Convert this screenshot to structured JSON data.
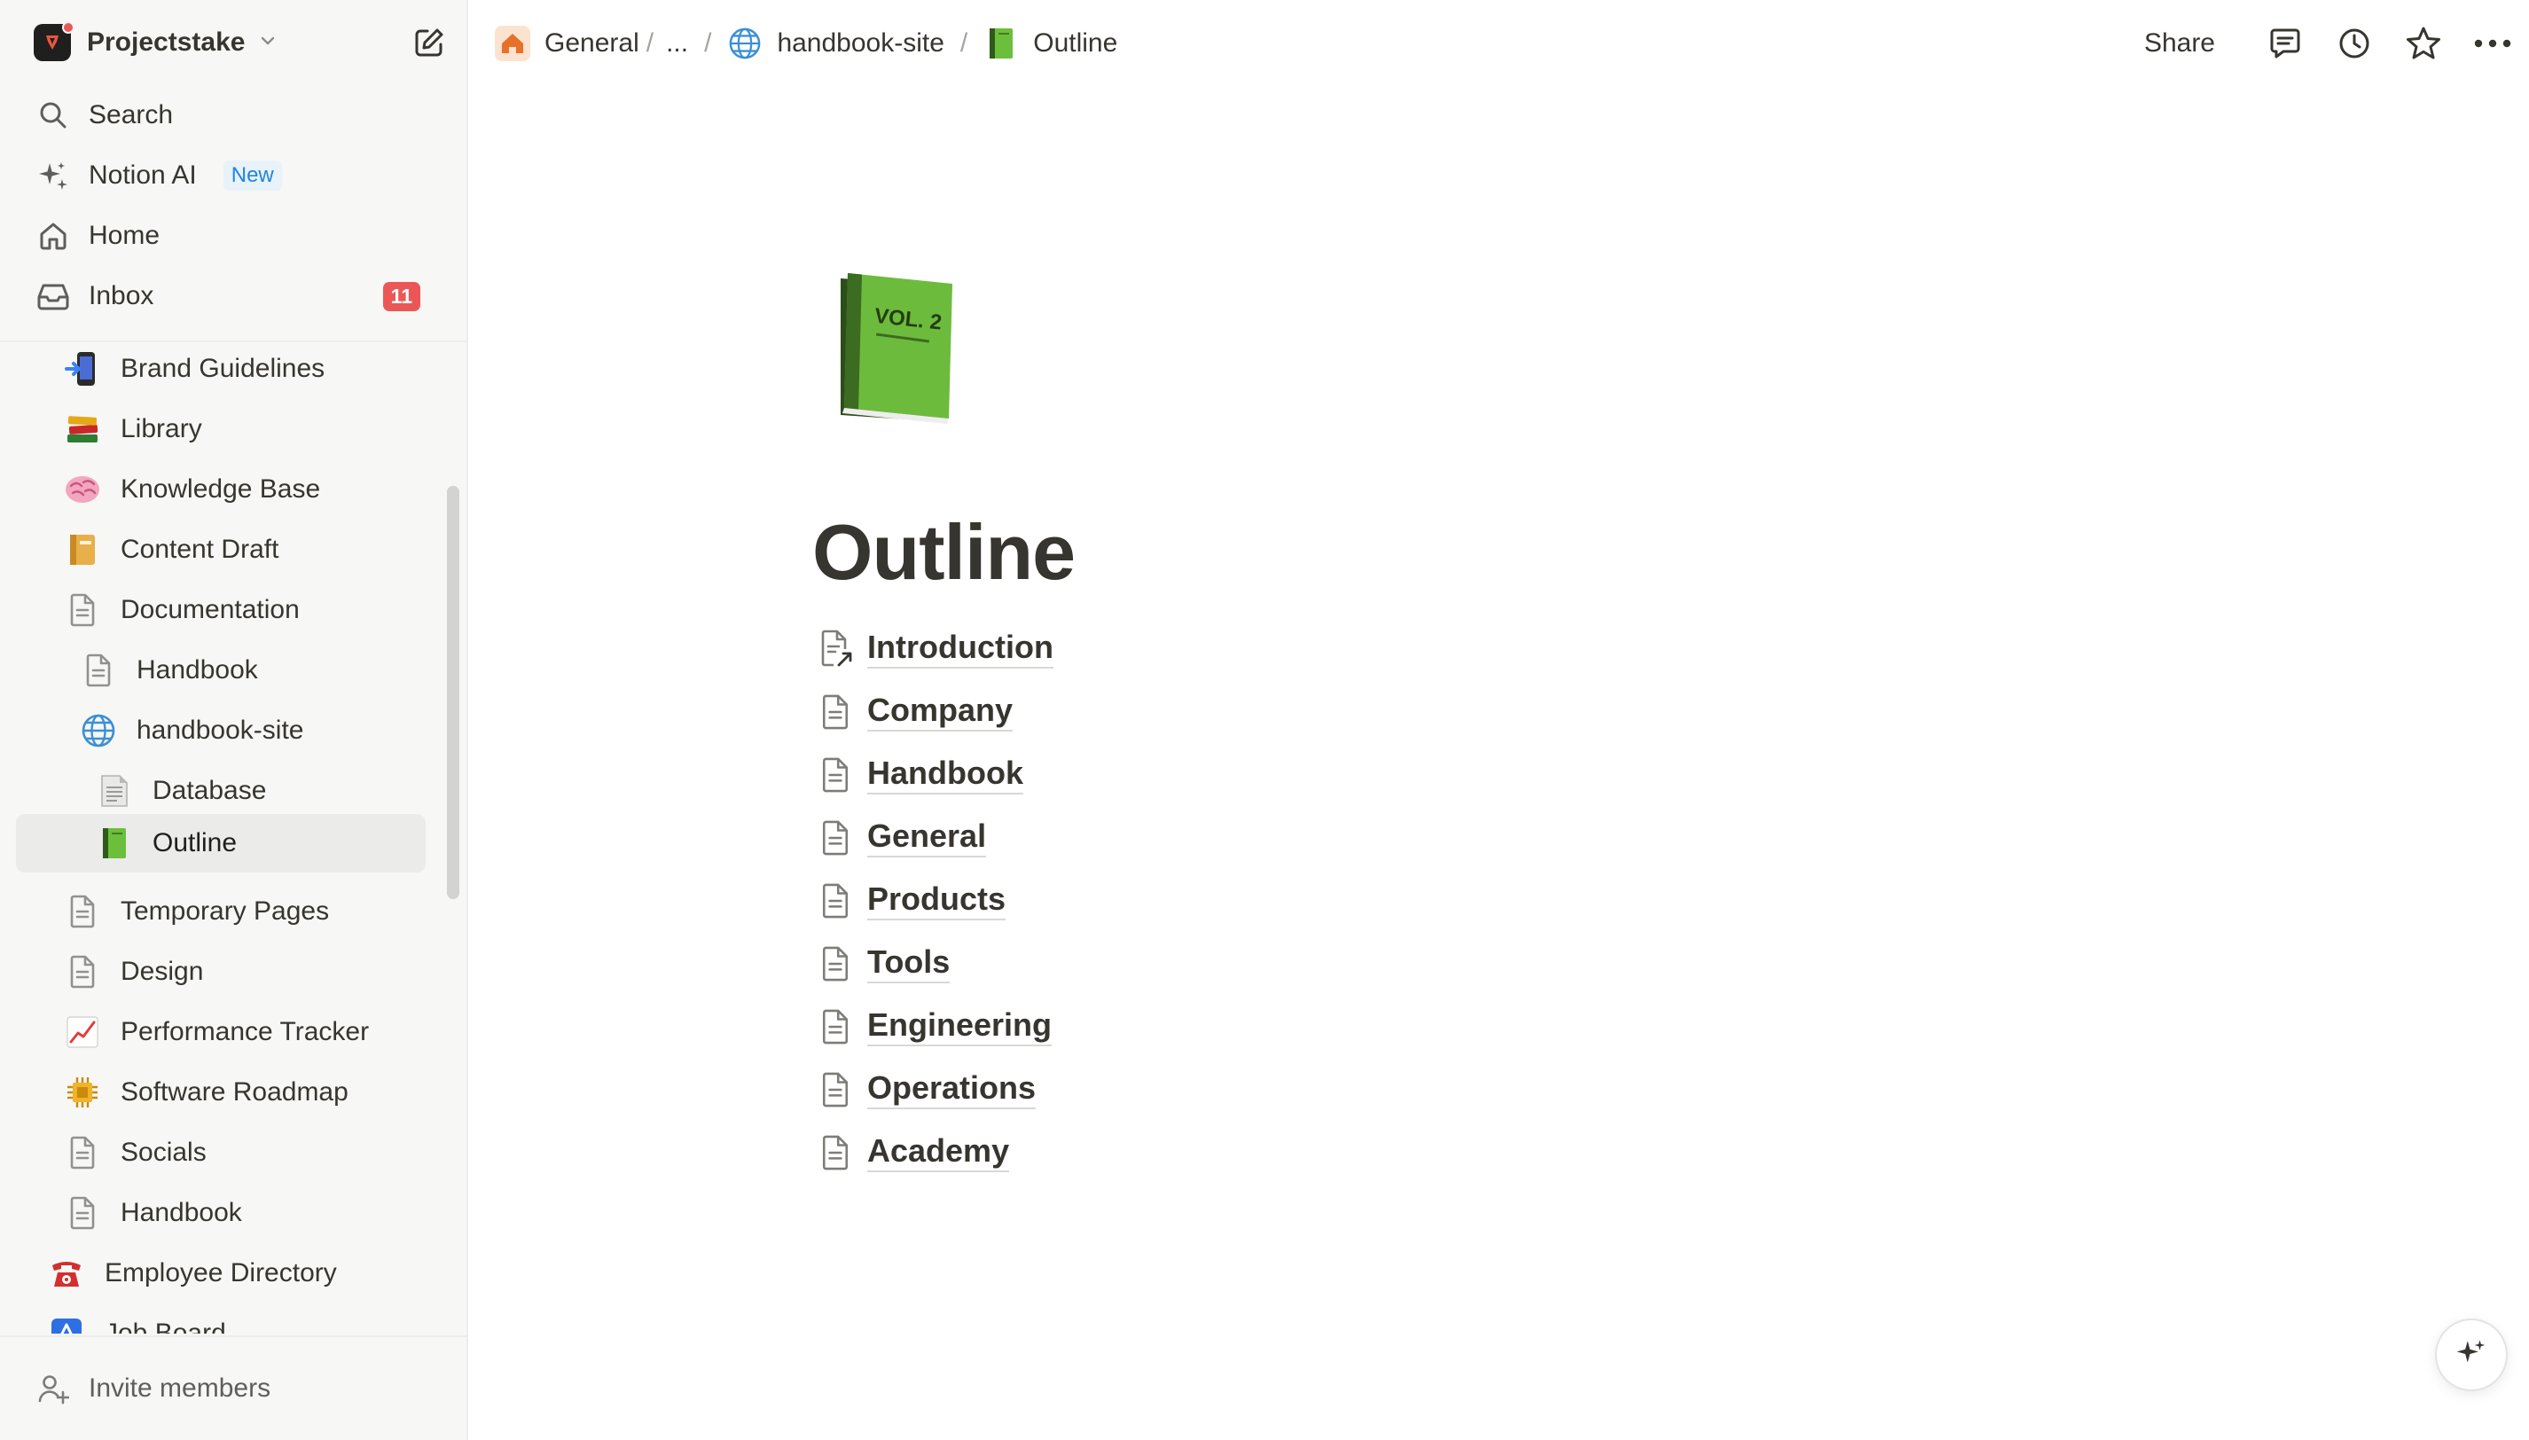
{
  "workspace": {
    "name": "Projectstake"
  },
  "nav": {
    "search": "Search",
    "notion_ai": "Notion AI",
    "notion_ai_badge": "New",
    "home": "Home",
    "inbox": "Inbox",
    "inbox_count": "11"
  },
  "tree": [
    {
      "label": "Brand Guidelines",
      "icon": "mobile-phone-arrow-icon"
    },
    {
      "label": "Library",
      "icon": "books-icon"
    },
    {
      "label": "Knowledge Base",
      "icon": "brain-icon"
    },
    {
      "label": "Content Draft",
      "icon": "ledger-icon"
    },
    {
      "label": "Documentation",
      "icon": "page-icon"
    },
    {
      "label": "Handbook",
      "icon": "page-icon"
    },
    {
      "label": "handbook-site",
      "icon": "globe-icon"
    },
    {
      "label": "Database",
      "icon": "page-facing-up-icon"
    },
    {
      "label": "Outline",
      "icon": "green-book-icon"
    },
    {
      "label": "Temporary Pages",
      "icon": "page-icon"
    },
    {
      "label": "Design",
      "icon": "page-icon"
    },
    {
      "label": "Performance Tracker",
      "icon": "chart-increasing-icon"
    },
    {
      "label": "Software Roadmap",
      "icon": "chip-icon"
    },
    {
      "label": "Socials",
      "icon": "page-icon"
    },
    {
      "label": "Handbook",
      "icon": "page-icon"
    },
    {
      "label": "Employee Directory",
      "icon": "telephone-icon"
    },
    {
      "label": "Job Board",
      "icon": "blue-square-icon"
    }
  ],
  "invite": "Invite members",
  "breadcrumb": {
    "root": "General",
    "root_sep": "/",
    "ellipsis": "...",
    "sep": "/",
    "parent": "handbook-site",
    "current": "Outline"
  },
  "top_actions": {
    "share": "Share"
  },
  "page": {
    "title": "Outline",
    "icon_text": "VOL. 2",
    "subpages": [
      {
        "label": "Introduction",
        "icon": "page-link-icon"
      },
      {
        "label": "Company",
        "icon": "page-icon"
      },
      {
        "label": "Handbook",
        "icon": "page-icon"
      },
      {
        "label": "General",
        "icon": "page-icon"
      },
      {
        "label": "Products",
        "icon": "page-icon"
      },
      {
        "label": "Tools",
        "icon": "page-icon"
      },
      {
        "label": "Engineering",
        "icon": "page-icon"
      },
      {
        "label": "Operations",
        "icon": "page-icon"
      },
      {
        "label": "Academy",
        "icon": "page-icon"
      }
    ]
  },
  "colors": {
    "sidebar_bg": "#f7f7f5",
    "text": "#37352f",
    "badge_red": "#eb5757",
    "new_blue": "#2383e2",
    "selected_bg": "#ebebea"
  }
}
